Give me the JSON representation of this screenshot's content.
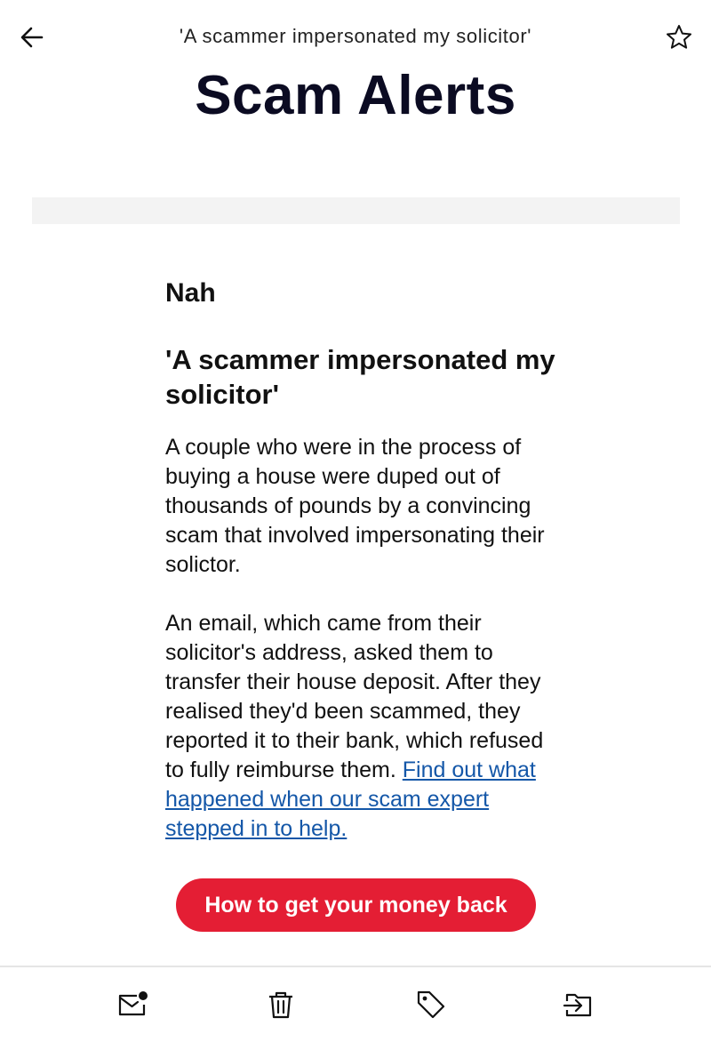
{
  "header": {
    "subject": "'A scammer impersonated my solicitor'",
    "title": "Scam Alerts",
    "back_icon": "arrow-left-icon",
    "star_icon": "star-outline-icon"
  },
  "message": {
    "sender": "Nah",
    "headline": "'A scammer impersonated my solicitor'",
    "paragraph1": "A couple who were in the process of buying a house were duped out of thousands of pounds by a convincing scam that involved impersonating their solictor.",
    "paragraph2": "An email, which came from their solicitor's address, asked them to transfer their house deposit. After they realised they'd been scammed, they reported it to their bank, which refused to fully reimburse them.",
    "link_text": "Find out what happened when our scam expert stepped in to help.",
    "cta_label": "How to get your money back"
  },
  "bottom_bar": {
    "icons": [
      "mark-unread-icon",
      "trash-icon",
      "label-tag-icon",
      "move-to-folder-icon"
    ]
  },
  "colors": {
    "accent": "#e41e34",
    "link": "#1457a8",
    "title": "#0b0b22"
  }
}
